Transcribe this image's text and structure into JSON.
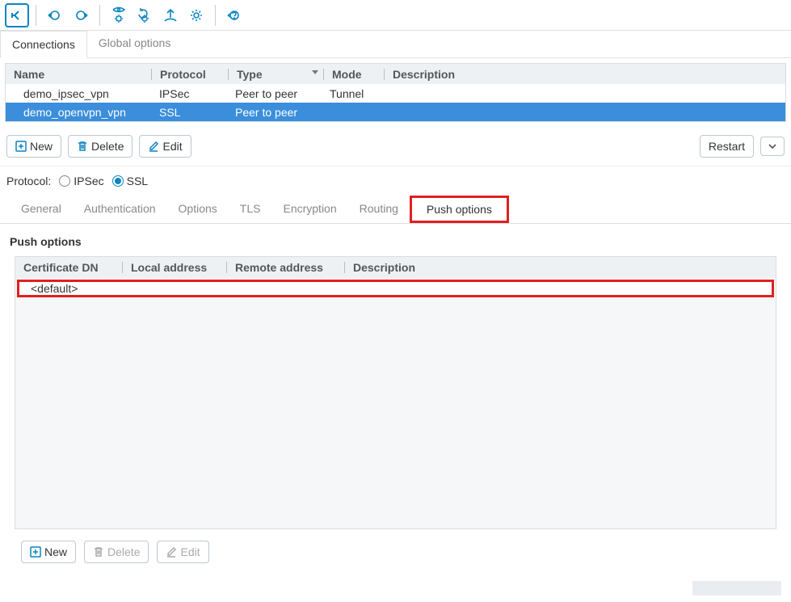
{
  "primary_tabs": {
    "connections": "Connections",
    "global_options": "Global options"
  },
  "grid": {
    "headers": {
      "name": "Name",
      "protocol": "Protocol",
      "type": "Type",
      "mode": "Mode",
      "description": "Description"
    },
    "rows": [
      {
        "name": "demo_ipsec_vpn",
        "protocol": "IPSec",
        "type": "Peer to peer",
        "mode": "Tunnel",
        "description": ""
      },
      {
        "name": "demo_openvpn_vpn",
        "protocol": "SSL",
        "type": "Peer to peer",
        "mode": "",
        "description": ""
      }
    ]
  },
  "buttons": {
    "new": "New",
    "delete": "Delete",
    "edit": "Edit",
    "restart": "Restart"
  },
  "protocol_row": {
    "label": "Protocol:",
    "ipsec": "IPSec",
    "ssl": "SSL"
  },
  "subtabs": [
    "General",
    "Authentication",
    "Options",
    "TLS",
    "Encryption",
    "Routing",
    "Push options"
  ],
  "active_subtab": "Push options",
  "section_title": "Push options",
  "inner_grid": {
    "headers": {
      "cert_dn": "Certificate DN",
      "local_addr": "Local address",
      "remote_addr": "Remote address",
      "description": "Description"
    },
    "row_default": "<default>"
  }
}
